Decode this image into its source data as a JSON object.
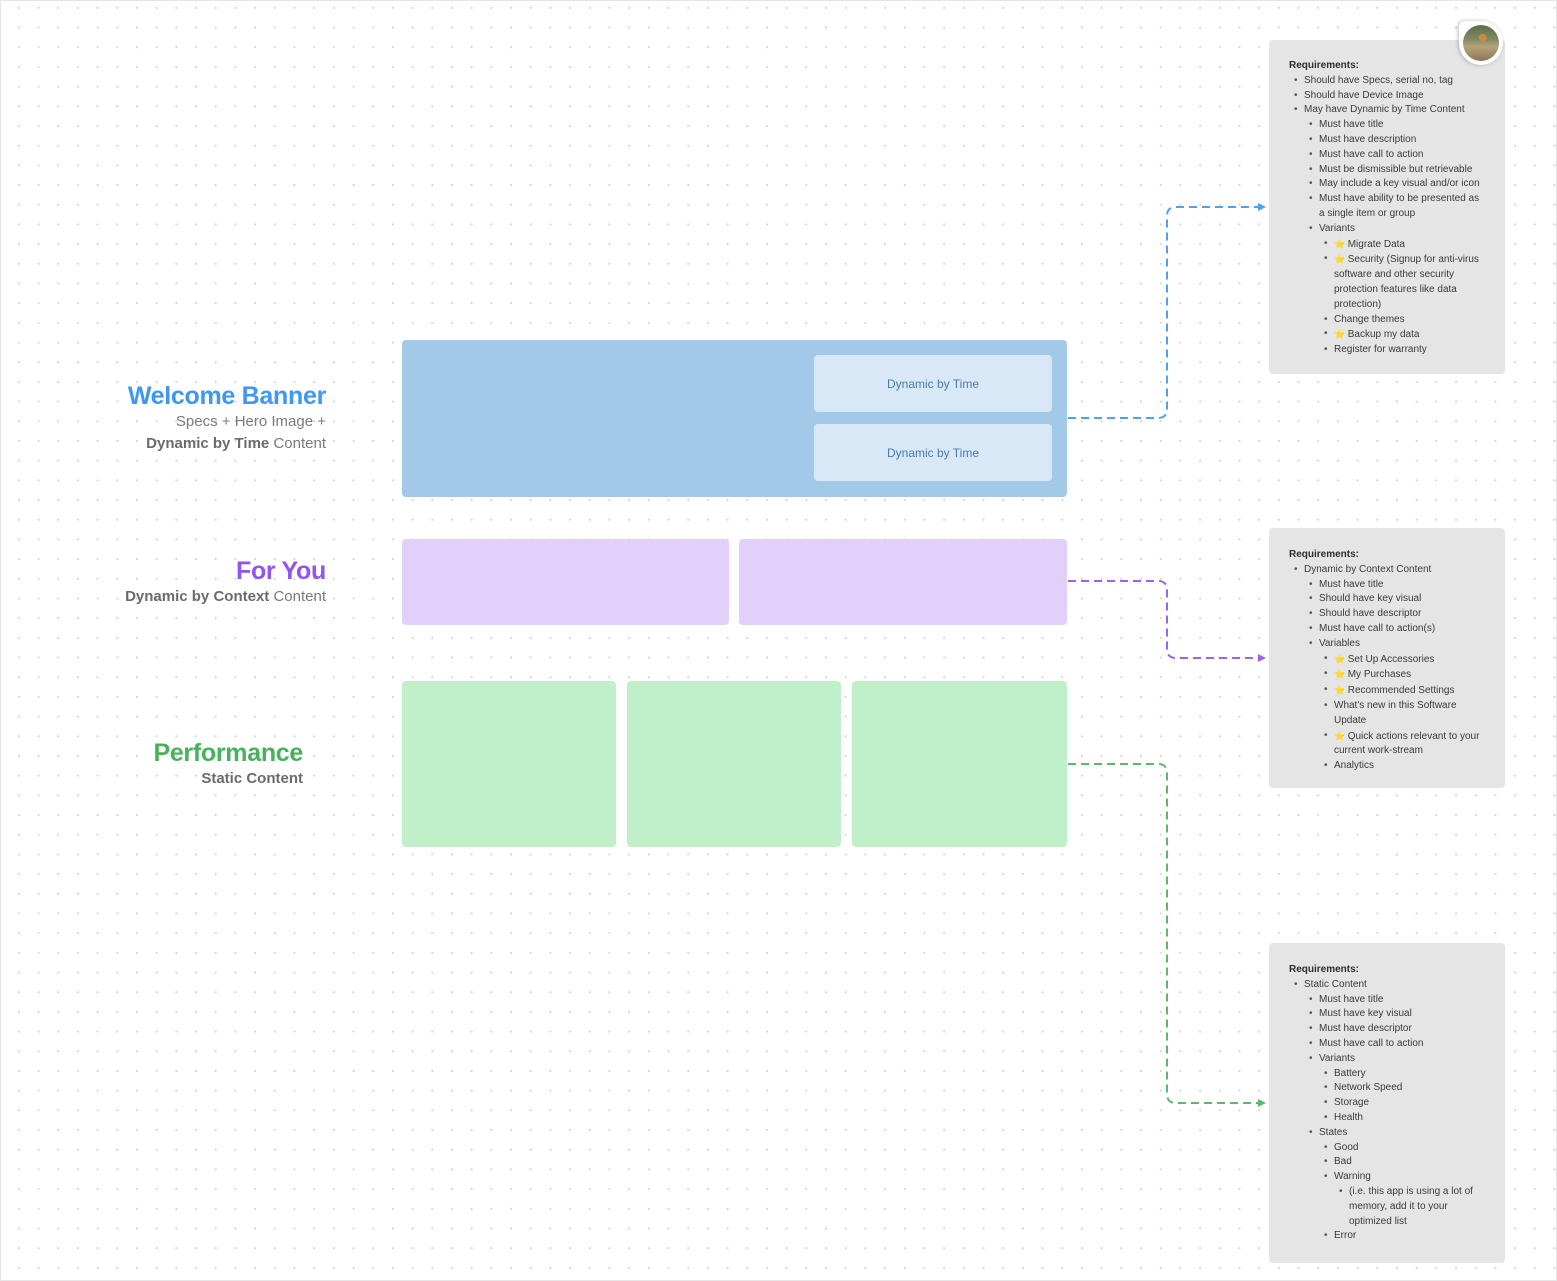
{
  "sections": {
    "welcome": {
      "title": "Welcome Banner",
      "sub_line1": "Specs + Hero Image +",
      "sub_bold": "Dynamic by Time",
      "sub_rest": " Content",
      "color": "#3f97f0",
      "cards": [
        "Dynamic by Time",
        "Dynamic by Time"
      ]
    },
    "foryou": {
      "title": "For You",
      "sub_bold": "Dynamic by Context",
      "sub_rest": " Content",
      "color": "#8e55f0"
    },
    "performance": {
      "title": "Performance",
      "sub_bold": "Static Content",
      "color": "#47b25c"
    }
  },
  "notes": {
    "welcome": {
      "heading": "Requirements:",
      "items": [
        {
          "text": "Should have Specs, serial no, tag",
          "level": 1
        },
        {
          "text": "Should have Device Image",
          "level": 1
        },
        {
          "text": "May have Dynamic by Time Content",
          "level": 1
        },
        {
          "text": "Must have title",
          "level": 2
        },
        {
          "text": "Must have description",
          "level": 2
        },
        {
          "text": "Must have call to action",
          "level": 2
        },
        {
          "text": "Must be dismissible but retrievable",
          "level": 2
        },
        {
          "text": "May include a key visual and/or icon",
          "level": 2
        },
        {
          "text": "Must have ability to be presented as a single item or group",
          "level": 2
        },
        {
          "text": "Variants",
          "level": 2
        },
        {
          "text": "Migrate Data",
          "level": 3,
          "star": true
        },
        {
          "text": "Security (Signup for anti-virus software and other security protection features like data protection)",
          "level": 3,
          "star": true
        },
        {
          "text": "Change themes",
          "level": 3
        },
        {
          "text": "Backup my data",
          "level": 3,
          "star": true
        },
        {
          "text": "Register for warranty",
          "level": 3
        }
      ]
    },
    "foryou": {
      "heading": "Requirements:",
      "items": [
        {
          "text": "Dynamic by Context Content",
          "level": 1
        },
        {
          "text": "Must have title",
          "level": 2
        },
        {
          "text": "Should have key visual",
          "level": 2
        },
        {
          "text": "Should have descriptor",
          "level": 2
        },
        {
          "text": "Must have call to action(s)",
          "level": 2
        },
        {
          "text": "Variables",
          "level": 2
        },
        {
          "text": "Set Up Accessories",
          "level": 3,
          "star": true
        },
        {
          "text": "My Purchases",
          "level": 3,
          "star": true
        },
        {
          "text": "Recommended Settings",
          "level": 3,
          "star": true
        },
        {
          "text": "What's new in this Software Update",
          "level": 3
        },
        {
          "text": "Quick actions relevant to your current work-stream",
          "level": 3,
          "star": true
        },
        {
          "text": "Analytics",
          "level": 3
        }
      ]
    },
    "performance": {
      "heading": "Requirements:",
      "items": [
        {
          "text": "Static Content",
          "level": 1
        },
        {
          "text": "Must have title",
          "level": 2
        },
        {
          "text": "Must have key visual",
          "level": 2
        },
        {
          "text": "Must have descriptor",
          "level": 2
        },
        {
          "text": "Must have call to action",
          "level": 2
        },
        {
          "text": "Variants",
          "level": 2
        },
        {
          "text": "Battery",
          "level": 3
        },
        {
          "text": "Network Speed",
          "level": 3
        },
        {
          "text": "Storage",
          "level": 3
        },
        {
          "text": "Health",
          "level": 3
        },
        {
          "text": "States",
          "level": 2
        },
        {
          "text": "Good",
          "level": 3
        },
        {
          "text": "Bad",
          "level": 3
        },
        {
          "text": "Warning",
          "level": 3
        },
        {
          "text": "(i.e. this app is using a lot of memory, add it to your optimized list",
          "level": 4
        },
        {
          "text": "Error",
          "level": 3
        }
      ]
    }
  },
  "icons": {
    "star": "⭐",
    "avatar": "user-avatar"
  }
}
